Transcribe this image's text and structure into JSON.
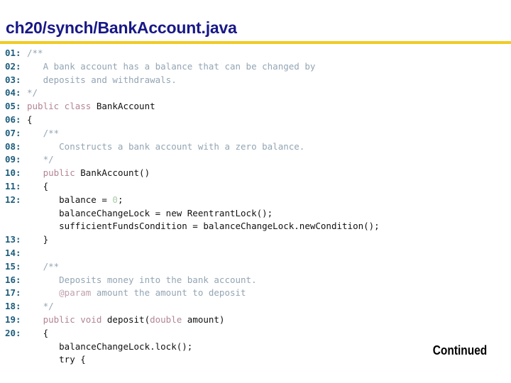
{
  "header": {
    "title": "ch20/synch/BankAccount.java",
    "rule_color": "#F0CB22",
    "title_color": "#181888"
  },
  "footer": {
    "continued_label": "Continued"
  },
  "code": {
    "language": "java",
    "colors": {
      "lineno": "#1C5C7C",
      "plain": "#111111",
      "keyword": "#B28592",
      "comment": "#93A5B4",
      "doctag": "#BFA0AE",
      "number": "#A7CBA7"
    },
    "lines": [
      {
        "no": "01:",
        "tokens": [
          {
            "t": "comment",
            "s": "/**"
          }
        ]
      },
      {
        "no": "02:",
        "tokens": [
          {
            "t": "comment",
            "s": "   A bank account has a balance that can be changed by"
          }
        ]
      },
      {
        "no": "03:",
        "tokens": [
          {
            "t": "comment",
            "s": "   deposits and withdrawals."
          }
        ]
      },
      {
        "no": "04:",
        "tokens": [
          {
            "t": "comment",
            "s": "*/"
          }
        ]
      },
      {
        "no": "05:",
        "tokens": [
          {
            "t": "keyword",
            "s": "public class "
          },
          {
            "t": "plain",
            "s": "BankAccount"
          }
        ]
      },
      {
        "no": "06:",
        "tokens": [
          {
            "t": "plain",
            "s": "{"
          }
        ]
      },
      {
        "no": "07:",
        "tokens": [
          {
            "t": "comment",
            "s": "   /**"
          }
        ]
      },
      {
        "no": "08:",
        "tokens": [
          {
            "t": "comment",
            "s": "      Constructs a bank account with a zero balance."
          }
        ]
      },
      {
        "no": "09:",
        "tokens": [
          {
            "t": "comment",
            "s": "   */"
          }
        ]
      },
      {
        "no": "10:",
        "tokens": [
          {
            "t": "keyword",
            "s": "   public "
          },
          {
            "t": "plain",
            "s": "BankAccount()"
          }
        ]
      },
      {
        "no": "11:",
        "tokens": [
          {
            "t": "plain",
            "s": "   {"
          }
        ]
      },
      {
        "no": "12:",
        "tokens": [
          {
            "t": "plain",
            "s": "      balance = "
          },
          {
            "t": "number",
            "s": "0"
          },
          {
            "t": "plain",
            "s": ";"
          }
        ]
      },
      {
        "no": "",
        "tokens": [
          {
            "t": "plain",
            "s": "      balanceChangeLock = new ReentrantLock();"
          }
        ]
      },
      {
        "no": "",
        "tokens": [
          {
            "t": "plain",
            "s": "      sufficientFundsCondition = balanceChangeLock.newCondition();"
          }
        ]
      },
      {
        "no": "13:",
        "tokens": [
          {
            "t": "plain",
            "s": "   }"
          }
        ]
      },
      {
        "no": "14:",
        "tokens": [
          {
            "t": "plain",
            "s": ""
          }
        ]
      },
      {
        "no": "15:",
        "tokens": [
          {
            "t": "comment",
            "s": "   /**"
          }
        ]
      },
      {
        "no": "16:",
        "tokens": [
          {
            "t": "comment",
            "s": "      Deposits money into the bank account."
          }
        ]
      },
      {
        "no": "17:",
        "tokens": [
          {
            "t": "doctag",
            "s": "      @param "
          },
          {
            "t": "comment",
            "s": "amount the amount to deposit"
          }
        ]
      },
      {
        "no": "18:",
        "tokens": [
          {
            "t": "comment",
            "s": "   */"
          }
        ]
      },
      {
        "no": "19:",
        "tokens": [
          {
            "t": "keyword",
            "s": "   public void "
          },
          {
            "t": "plain",
            "s": "deposit("
          },
          {
            "t": "keyword",
            "s": "double"
          },
          {
            "t": "plain",
            "s": " amount)"
          }
        ]
      },
      {
        "no": "20:",
        "tokens": [
          {
            "t": "plain",
            "s": "   {"
          }
        ]
      },
      {
        "no": "",
        "tokens": [
          {
            "t": "plain",
            "s": "      balanceChangeLock.lock();"
          }
        ]
      },
      {
        "no": "",
        "tokens": [
          {
            "t": "plain",
            "s": "      try {"
          }
        ]
      }
    ]
  }
}
